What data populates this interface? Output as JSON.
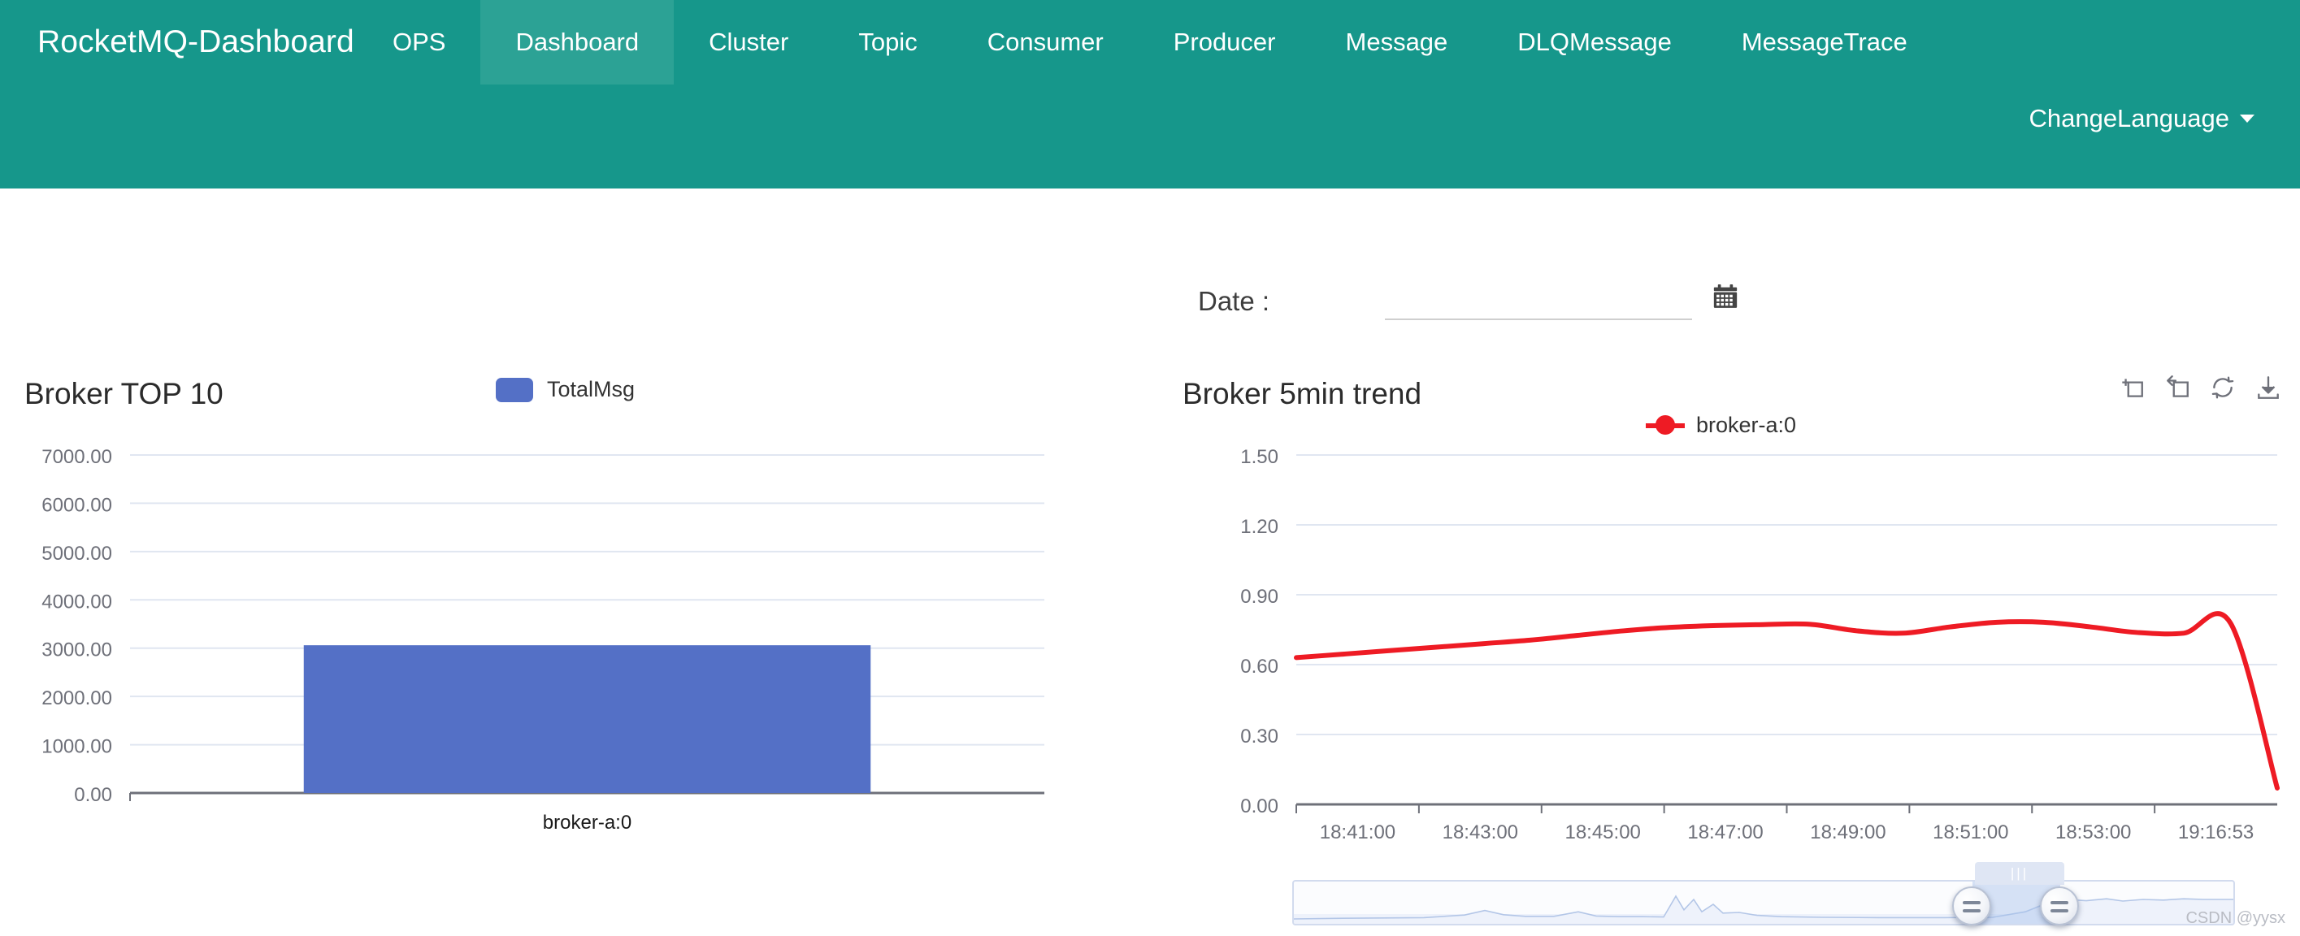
{
  "navbar": {
    "brand": "RocketMQ-Dashboard",
    "accent_color": "#16978B",
    "active_color": "#2CA295",
    "items": [
      {
        "label": "OPS",
        "active": false
      },
      {
        "label": "Dashboard",
        "active": true
      },
      {
        "label": "Cluster",
        "active": false
      },
      {
        "label": "Topic",
        "active": false
      },
      {
        "label": "Consumer",
        "active": false
      },
      {
        "label": "Producer",
        "active": false
      },
      {
        "label": "Message",
        "active": false
      },
      {
        "label": "DLQMessage",
        "active": false
      },
      {
        "label": "MessageTrace",
        "active": false
      }
    ],
    "language_label": "ChangeLanguage",
    "caret_icon": "chevron-down-icon"
  },
  "filter": {
    "date_label": "Date :",
    "date_value": "",
    "date_placeholder": "",
    "calendar_icon": "calendar-icon"
  },
  "bar_panel": {
    "title": "Broker TOP 10",
    "legend": {
      "label": "TotalMsg",
      "color": "#5470C6"
    }
  },
  "line_panel": {
    "title": "Broker 5min trend",
    "legend": {
      "label": "broker-a:0",
      "color": "#EE1B24"
    },
    "toolbox": [
      {
        "name": "data-zoom-icon",
        "title": "Data Zoom"
      },
      {
        "name": "restore-zoom-icon",
        "title": "Restore"
      },
      {
        "name": "refresh-icon",
        "title": "Refresh"
      },
      {
        "name": "download-icon",
        "title": "Save as Image"
      }
    ]
  },
  "datazoom": {
    "handle_left_icon": "slider-handle-icon",
    "handle_right_icon": "slider-handle-icon",
    "tip": "|||"
  },
  "watermark": "CSDN @yysx",
  "chart_data": [
    {
      "type": "bar",
      "title": "Broker TOP 10",
      "categories": [
        "broker-a:0"
      ],
      "series": [
        {
          "name": "TotalMsg",
          "values": [
            3060
          ],
          "color": "#5470C6"
        }
      ],
      "xlabel": "",
      "ylabel": "",
      "ylim": [
        0,
        7000
      ],
      "yticks": [
        "0.00",
        "1000.00",
        "2000.00",
        "3000.00",
        "4000.00",
        "5000.00",
        "6000.00",
        "7000.00"
      ],
      "ytick_values": [
        0,
        1000,
        2000,
        3000,
        4000,
        5000,
        6000,
        7000
      ],
      "grid": true,
      "legend_position": "top-center"
    },
    {
      "type": "line",
      "title": "Broker 5min trend",
      "xlabel": "",
      "ylabel": "",
      "ylim": [
        0,
        1.5
      ],
      "yticks": [
        "0.00",
        "0.30",
        "0.60",
        "0.90",
        "1.20",
        "1.50"
      ],
      "ytick_values": [
        0,
        0.3,
        0.6,
        0.9,
        1.2,
        1.5
      ],
      "xticks": [
        "18:41:00",
        "18:43:00",
        "18:45:00",
        "18:47:00",
        "18:49:00",
        "18:51:00",
        "18:53:00",
        "19:16:53"
      ],
      "grid": true,
      "legend_position": "top-center",
      "series": [
        {
          "name": "broker-a:0",
          "color": "#EE1B24",
          "smooth": true,
          "x": [
            "18:41:00",
            "18:41:40",
            "18:42:20",
            "18:43:00",
            "18:43:40",
            "18:44:20",
            "18:45:00",
            "18:45:40",
            "18:46:20",
            "18:47:00",
            "18:47:40",
            "18:48:20",
            "18:49:00",
            "18:49:40",
            "18:50:20",
            "18:51:00",
            "18:51:40",
            "18:52:20",
            "18:53:00",
            "18:53:40",
            "18:54:20",
            "19:16:53"
          ],
          "values": [
            0.63,
            0.645,
            0.66,
            0.675,
            0.69,
            0.705,
            0.725,
            0.745,
            0.76,
            0.768,
            0.772,
            0.773,
            0.745,
            0.735,
            0.762,
            0.782,
            0.782,
            0.762,
            0.738,
            0.735,
            0.778,
            0.07
          ]
        }
      ]
    }
  ]
}
